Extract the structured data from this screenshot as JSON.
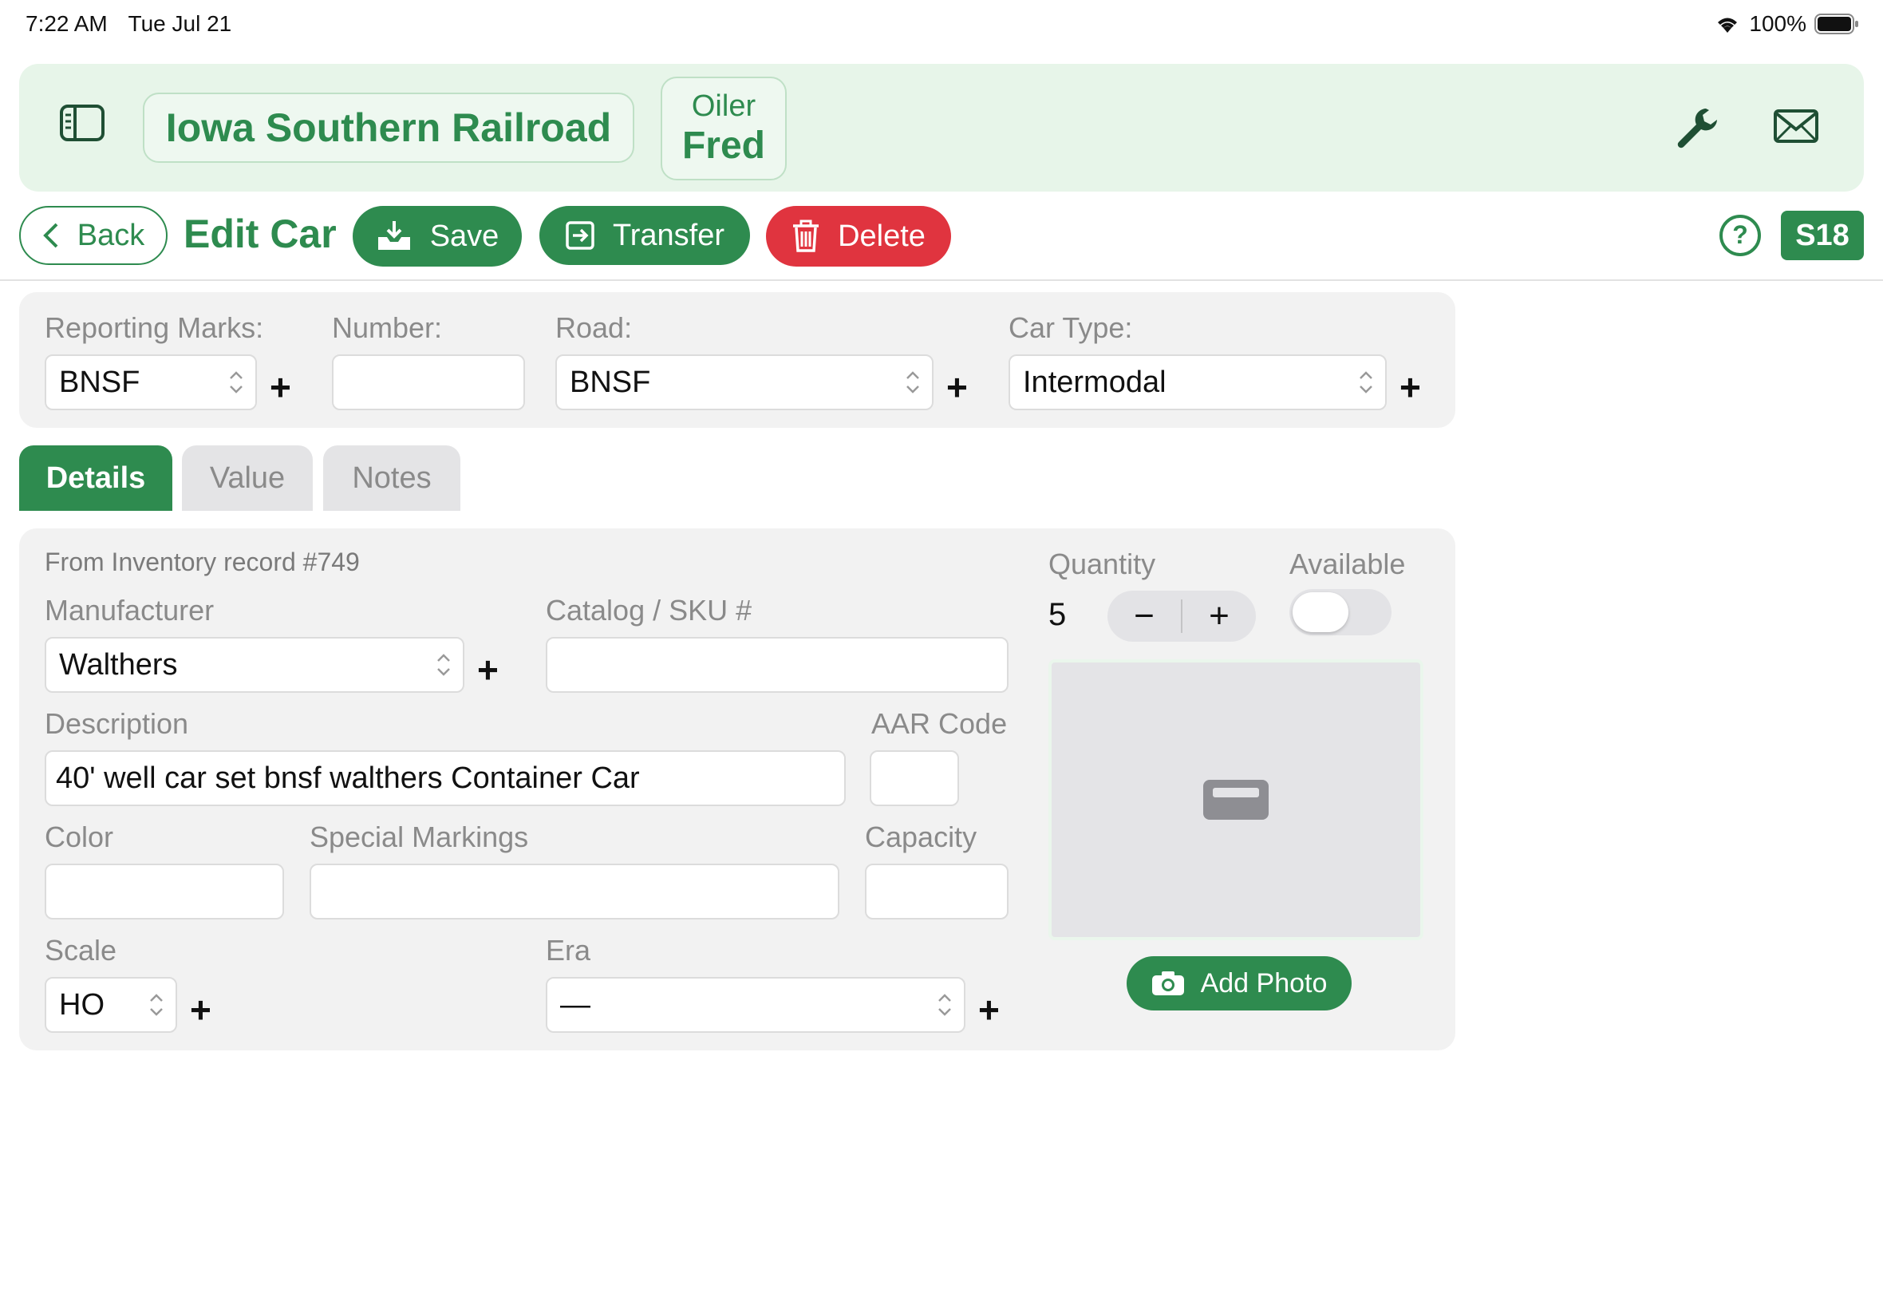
{
  "status": {
    "time": "7:22 AM",
    "date": "Tue Jul 21",
    "battery": "100%"
  },
  "header": {
    "railroad": "Iowa Southern Railroad",
    "role": "Oiler",
    "user": "Fred"
  },
  "toolbar": {
    "back_label": "Back",
    "title": "Edit Car",
    "save_label": "Save",
    "transfer_label": "Transfer",
    "delete_label": "Delete",
    "badge": "S18"
  },
  "car": {
    "reporting_marks_label": "Reporting Marks:",
    "reporting_marks_value": "BNSF",
    "number_label": "Number:",
    "number_value": "",
    "road_label": "Road:",
    "road_value": "BNSF",
    "car_type_label": "Car Type:",
    "car_type_value": "Intermodal"
  },
  "tabs": [
    {
      "label": "Details",
      "active": true
    },
    {
      "label": "Value",
      "active": false
    },
    {
      "label": "Notes",
      "active": false
    }
  ],
  "details": {
    "inventory_note": "From Inventory record #749",
    "manufacturer_label": "Manufacturer",
    "manufacturer_value": "Walthers",
    "catalog_label": "Catalog / SKU #",
    "catalog_value": "",
    "description_label": "Description",
    "description_value": "40' well car set bnsf walthers Container Car",
    "aar_label": "AAR Code",
    "aar_value": "",
    "color_label": "Color",
    "color_value": "",
    "special_label": "Special Markings",
    "special_value": "",
    "capacity_label": "Capacity",
    "capacity_value": "",
    "scale_label": "Scale",
    "scale_value": "HO",
    "era_label": "Era",
    "era_value": "—",
    "quantity_label": "Quantity",
    "quantity_value": "5",
    "available_label": "Available",
    "available_on": false,
    "add_photo_label": "Add Photo"
  },
  "colors": {
    "accent": "#2e8b4f",
    "danger": "#e0343f",
    "banner": "#e7f5e9"
  }
}
